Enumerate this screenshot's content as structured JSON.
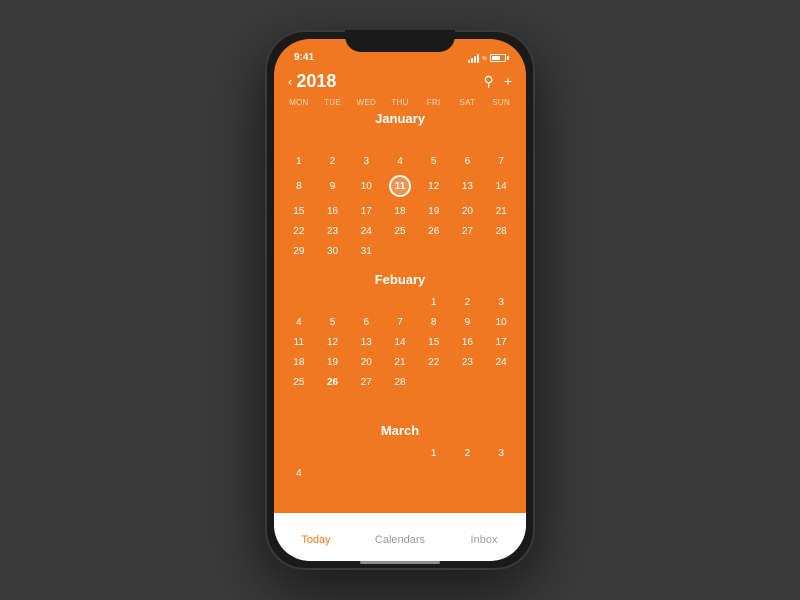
{
  "phone": {
    "status": {
      "time": "9:41",
      "signal_bars": [
        3,
        5,
        7,
        9,
        11
      ],
      "battery_label": "battery"
    },
    "header": {
      "back_arrow": "‹",
      "year": "2018",
      "search_icon": "🔍",
      "add_icon": "+"
    },
    "days_of_week": [
      "MON",
      "TUE",
      "WED",
      "THU",
      "FRI",
      "SAT",
      "SUN"
    ],
    "months": [
      {
        "name": "January",
        "weeks": [
          [
            "",
            "",
            "",
            "",
            "",
            "",
            ""
          ],
          [
            "1",
            "2",
            "3",
            "4",
            "5",
            "6",
            "7"
          ],
          [
            "8",
            "9",
            "10",
            "11",
            "12",
            "13",
            "14"
          ],
          [
            "15",
            "16",
            "17",
            "18",
            "19",
            "20",
            "21"
          ],
          [
            "22",
            "23",
            "24",
            "25",
            "26",
            "27",
            "28"
          ],
          [
            "29",
            "30",
            "31",
            "",
            "",
            "",
            ""
          ]
        ],
        "today": "11",
        "bold_dates": [
          "26"
        ]
      },
      {
        "name": "Febuary",
        "weeks": [
          [
            "",
            "",
            "",
            "",
            "1",
            "2",
            "3",
            "4"
          ],
          [
            "5",
            "6",
            "7",
            "8",
            "9",
            "10",
            "11"
          ],
          [
            "12",
            "13",
            "14",
            "15",
            "16",
            "17",
            "18"
          ],
          [
            "19",
            "20",
            "21",
            "22",
            "23",
            "24",
            "25"
          ],
          [
            "26",
            "27",
            "28",
            "",
            "",
            "",
            ""
          ]
        ],
        "today": null,
        "bold_dates": [
          "26"
        ]
      },
      {
        "name": "March",
        "weeks": [
          [
            "",
            "",
            "",
            "",
            "1",
            "2",
            "3",
            "4"
          ]
        ],
        "today": null,
        "bold_dates": []
      }
    ],
    "tabs": [
      {
        "label": "Today",
        "active": true
      },
      {
        "label": "Calendars",
        "active": false
      },
      {
        "label": "Inbox",
        "active": false
      }
    ]
  }
}
